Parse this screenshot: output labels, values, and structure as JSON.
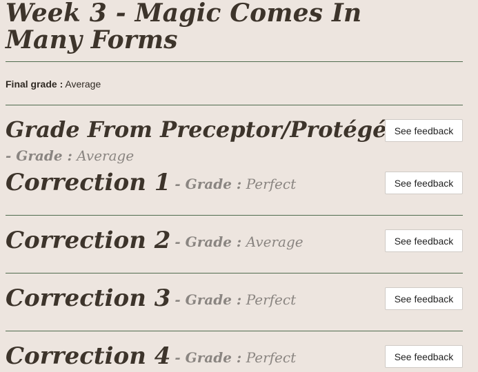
{
  "week": {
    "title": "Week 3 - Magic Comes In Many Forms"
  },
  "final_grade": {
    "label": "Final grade :",
    "value": "Average"
  },
  "preceptor": {
    "title": "Grade From Preceptor/Protégé",
    "grade_label": "- Grade :",
    "grade_value": "Average",
    "button_label": "See feedback"
  },
  "corrections": [
    {
      "title": "Correction 1",
      "grade_label": "- Grade :",
      "grade_value": "Perfect",
      "button_label": "See feedback"
    },
    {
      "title": "Correction 2",
      "grade_label": "- Grade :",
      "grade_value": "Average",
      "button_label": "See feedback"
    },
    {
      "title": "Correction 3",
      "grade_label": "- Grade :",
      "grade_value": "Perfect",
      "button_label": "See feedback"
    },
    {
      "title": "Correction 4",
      "grade_label": "- Grade :",
      "grade_value": "Perfect",
      "button_label": "See feedback"
    }
  ]
}
